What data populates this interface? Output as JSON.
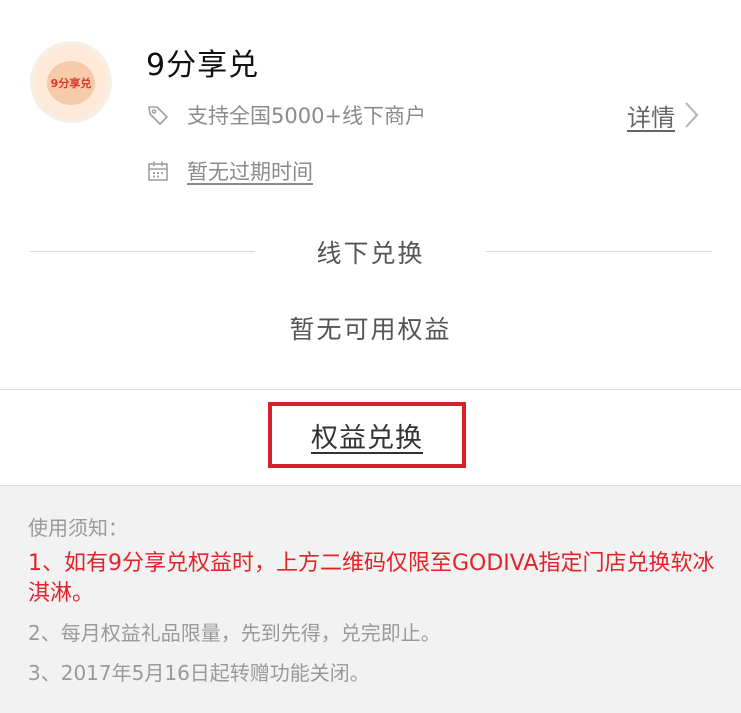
{
  "merchant": {
    "name": "9分享兑",
    "logo_text": "9分享兑",
    "support_text": "支持全国5000+线下商户",
    "expiry_text": "暂无过期时间",
    "detail_label": "详情"
  },
  "section": {
    "title": "线下兑换",
    "empty_text": "暂无可用权益"
  },
  "redeem": {
    "label": "权益兑换",
    "highlight_color": "#d9212b"
  },
  "notice": {
    "heading": "使用须知：",
    "items": [
      "1、如有9分享兑权益时，上方二维码仅限至GODIVA指定门店兑换软冰淇淋。",
      "2、每月权益礼品限量，先到先得，兑完即止。",
      "3、2017年5月16日起转赠功能关闭。"
    ],
    "highlight_color": "#e2242a"
  },
  "icons": {
    "tag": "tag-icon",
    "calendar": "calendar-icon",
    "chevron": "chevron-right-icon"
  }
}
